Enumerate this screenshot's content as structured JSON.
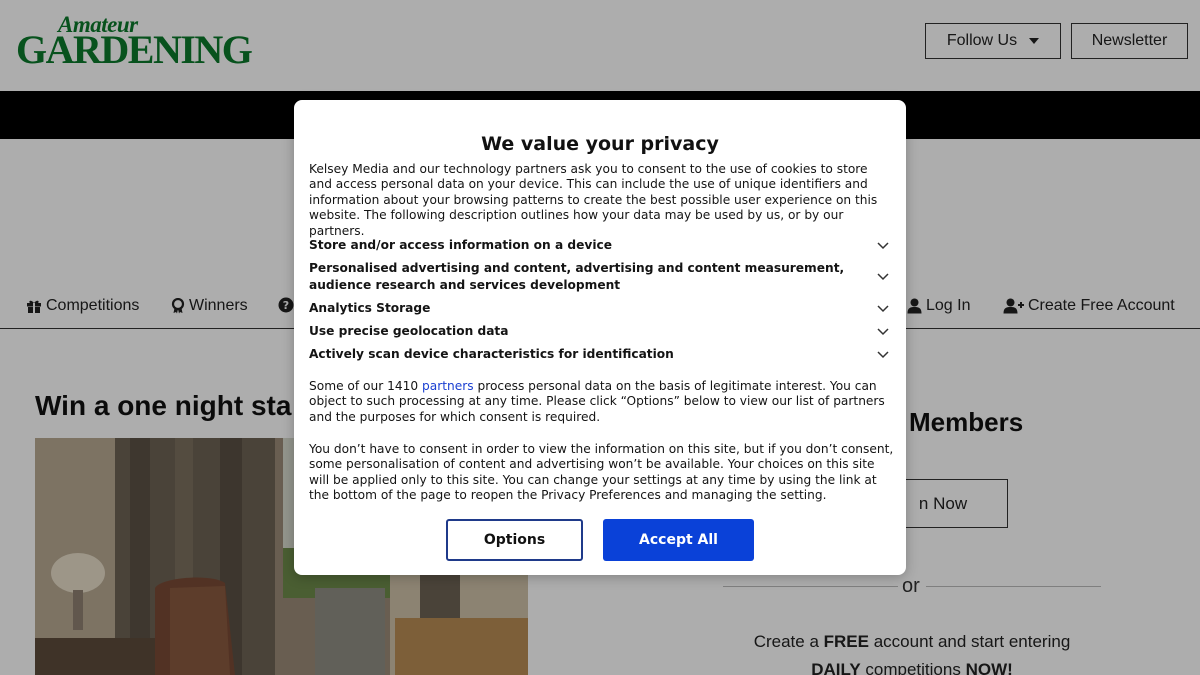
{
  "header": {
    "logo_top": "Amateur",
    "logo_main": "GARDENING",
    "follow_label": "Follow Us",
    "newsletter_label": "Newsletter"
  },
  "nav": {
    "items": [
      {
        "label": "Competitions",
        "icon": "gift-icon"
      },
      {
        "label": "Winners",
        "icon": "award-icon"
      },
      {
        "label": "",
        "icon": "question-circle-icon"
      },
      {
        "label": "Log In",
        "icon": "user-icon"
      },
      {
        "label": "Create Free Account",
        "icon": "user-plus-icon"
      }
    ]
  },
  "main": {
    "title_partial": "Win a one night sta"
  },
  "sidebar": {
    "members_title_partial": "Members",
    "join_partial": "n Now",
    "or_text": "or",
    "promo_pre": "Create a ",
    "promo_free": "FREE",
    "promo_mid": " account and start entering",
    "promo_daily": "DAILY",
    "promo_comp": " competitions ",
    "promo_now": "NOW!"
  },
  "privacy_modal": {
    "title": "We value your privacy",
    "intro": "Kelsey Media and our technology partners ask you to consent to the use of cookies to store and access personal data on your device. This can include the use of unique identifiers and information about your browsing patterns to create the best possible user experience on this website. The following description outlines how your data may be used by us, or by our partners.",
    "purposes": [
      "Store and/or access information on a device",
      "Personalised advertising and content, advertising and content measurement, audience research and services development",
      "Analytics Storage",
      "Use precise geolocation data",
      "Actively scan device characteristics for identification"
    ],
    "legit_pre": "Some of our 1410 ",
    "legit_link": "partners",
    "legit_post": " process personal data on the basis of legitimate interest. You can object to such processing at any time. Please click “Options” below to view our list of partners and the purposes for which consent is required.",
    "consent_text": "You don’t have to consent in order to view the information on this site, but if you don’t consent, some personalisation of content and advertising won’t be available. Your choices on this site will be applied only to this site. You can change your settings at any time by using the link at the bottom of the page to reopen the Privacy Preferences and managing the setting.",
    "options_label": "Options",
    "accept_label": "Accept All"
  },
  "colors": {
    "logo_green": "#0b7a2b",
    "accept_blue": "#0a41d8",
    "options_border": "#1f3a8a",
    "link_blue": "#1a3fd1"
  }
}
